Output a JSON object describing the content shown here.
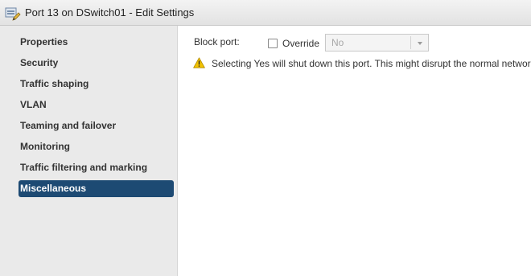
{
  "window": {
    "title": "Port 13 on DSwitch01 - Edit Settings",
    "icon": "port-settings-icon"
  },
  "sidebar": {
    "items": [
      {
        "label": "Properties",
        "active": false
      },
      {
        "label": "Security",
        "active": false
      },
      {
        "label": "Traffic shaping",
        "active": false
      },
      {
        "label": "VLAN",
        "active": false
      },
      {
        "label": "Teaming and failover",
        "active": false
      },
      {
        "label": "Monitoring",
        "active": false
      },
      {
        "label": "Traffic filtering and marking",
        "active": false
      },
      {
        "label": "Miscellaneous",
        "active": true
      }
    ]
  },
  "content": {
    "block_port_label": "Block port:",
    "override_label": "Override",
    "override_checked": false,
    "select_value": "No",
    "select_enabled": false,
    "warning_icon": "warning-triangle-icon",
    "warning_text": "Selecting Yes will shut down this port. This might disrupt the normal network operations."
  },
  "colors": {
    "active_nav_bg": "#1d4a73",
    "sidebar_bg": "#eaeaea",
    "warning_yellow": "#f2c200"
  }
}
